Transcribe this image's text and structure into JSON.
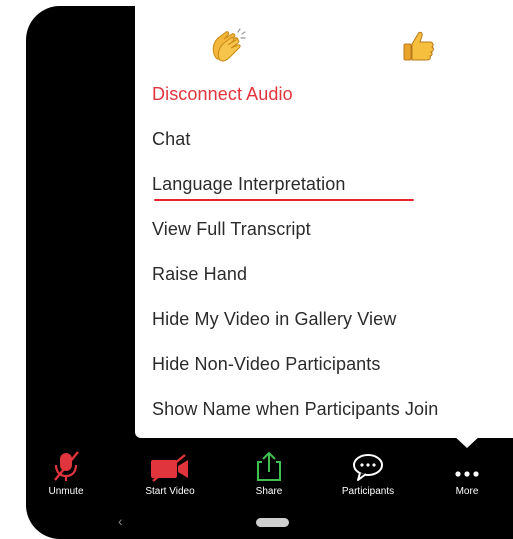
{
  "reactions": [
    {
      "name": "clapping-hands-icon"
    },
    {
      "name": "thumbs-up-icon"
    }
  ],
  "menu": {
    "items": [
      {
        "label": "Disconnect Audio",
        "style": "danger"
      },
      {
        "label": "Chat"
      },
      {
        "label": "Language Interpretation",
        "highlighted": true
      },
      {
        "label": "View Full Transcript"
      },
      {
        "label": "Raise Hand"
      },
      {
        "label": "Hide My Video in Gallery View"
      },
      {
        "label": "Hide Non-Video Participants"
      },
      {
        "label": "Show Name when Participants Join"
      }
    ]
  },
  "toolbar": {
    "unmute": {
      "label": "Unmute",
      "icon": "muted-microphone-icon"
    },
    "start_video": {
      "label": "Start Video",
      "icon": "video-off-icon"
    },
    "share": {
      "label": "Share",
      "icon": "share-icon"
    },
    "participants": {
      "label": "Participants",
      "icon": "participants-chat-icon"
    },
    "more": {
      "label": "More",
      "icon": "more-dots-icon"
    }
  },
  "colors": {
    "danger": "#e0353c",
    "highlight_underline": "#e8232f",
    "share_green": "#3fbf4f",
    "toolbar_bg": "#000000",
    "menu_bg": "#ffffff"
  }
}
